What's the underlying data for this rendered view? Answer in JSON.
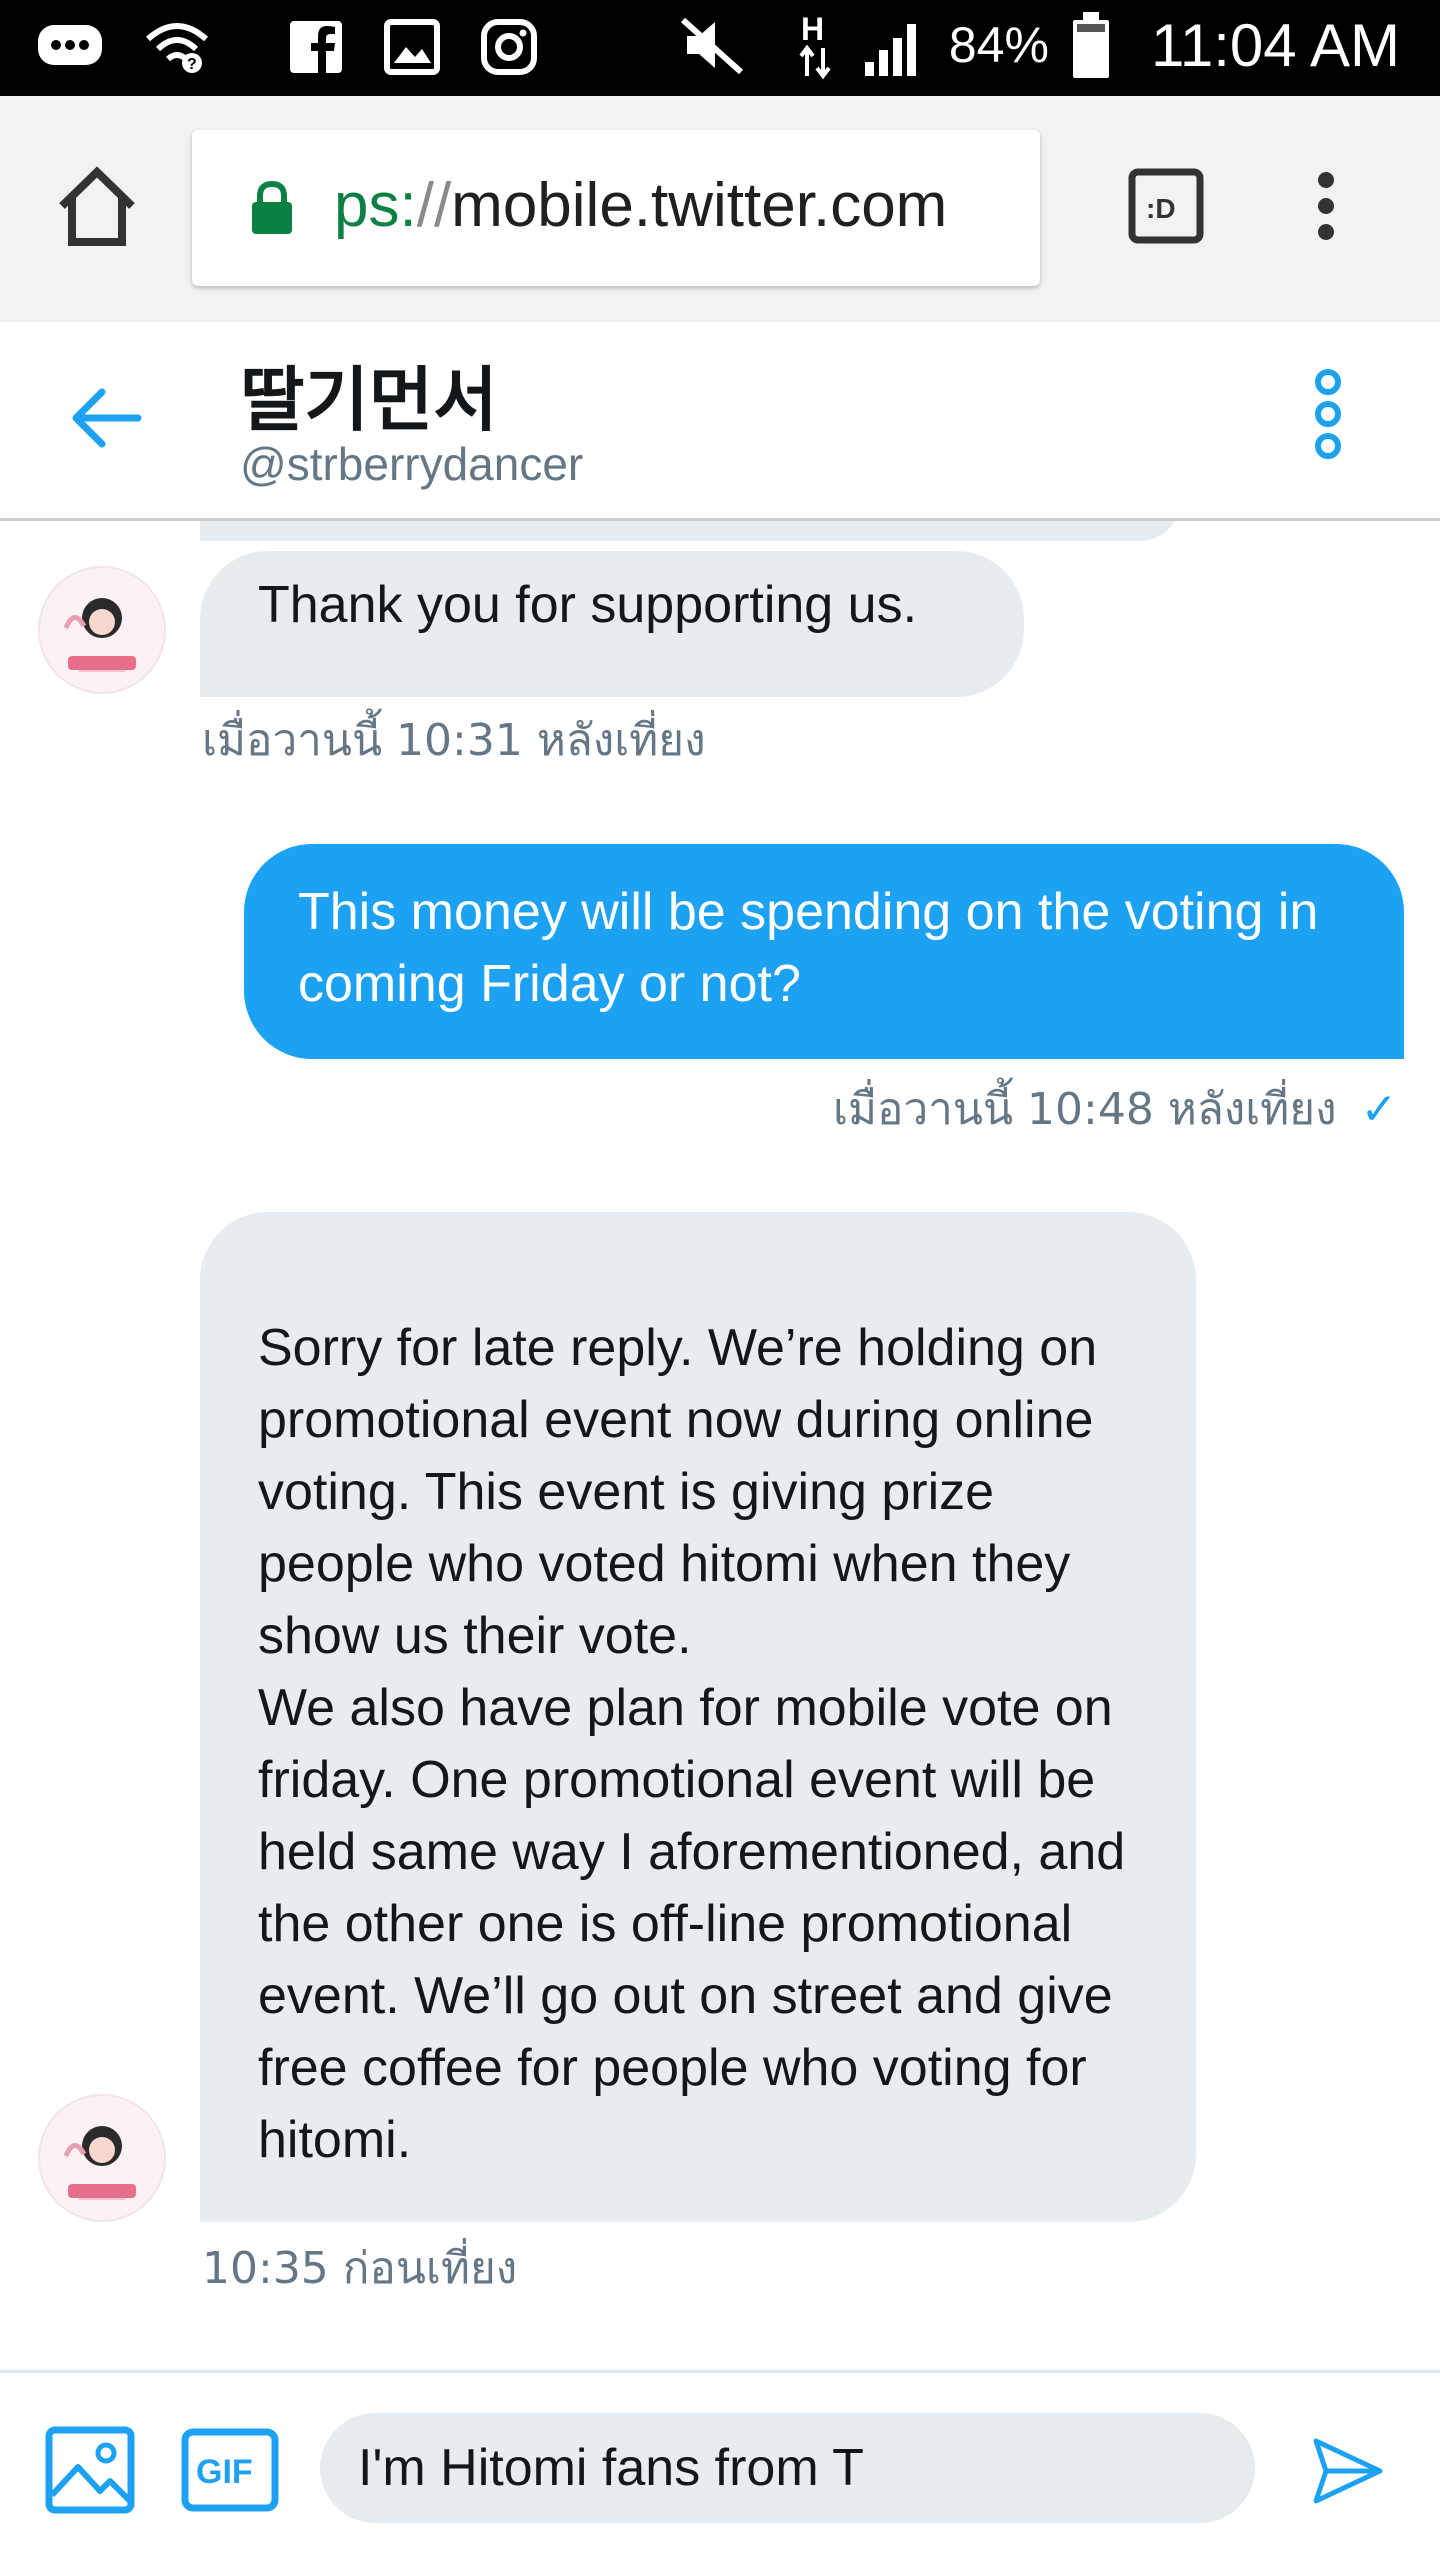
{
  "status_bar": {
    "battery": "84%",
    "time": "11:04 AM",
    "network": "H",
    "icons": [
      "messages-icon",
      "wifi-icon",
      "facebook-icon",
      "gallery-icon",
      "instagram-icon",
      "mute-icon",
      "signal-icon",
      "battery-icon"
    ]
  },
  "browser": {
    "url_scheme": "ps:",
    "url_slashes": "//",
    "url_host": "mobile.twitter.com",
    "tab_label": ":D"
  },
  "header": {
    "name": "딸기먼서",
    "handle": "@strberrydancer"
  },
  "messages": [
    {
      "direction": "in",
      "text": "Thank you for supporting us.",
      "time": "เมื่อวานนี้ 10:31 หลังเที่ยง"
    },
    {
      "direction": "out",
      "text": "This money will be spending on the voting in coming Friday or not?",
      "time": "เมื่อวานนี้ 10:48 หลังเที่ยง",
      "read_mark": "✓"
    },
    {
      "direction": "in",
      "text": "Sorry for late reply. We’re holding on promotional event now during online voting. This event is giving prize people who voted hitomi when they show us their vote.\nWe also have plan for mobile vote on friday. One promotional event will be held same way I aforementioned, and the other one is off-line promotional event. We’ll go out on street and give free coffee for people who voting for hitomi.",
      "time": "10:35 ก่อนเที่ยง"
    }
  ],
  "composer": {
    "text": "I'm Hitomi fans from T",
    "gif_label": "GIF"
  },
  "colors": {
    "accent": "#1da1f2",
    "incoming_bubble": "#e6ecf0",
    "secure_green": "#0b8043"
  }
}
